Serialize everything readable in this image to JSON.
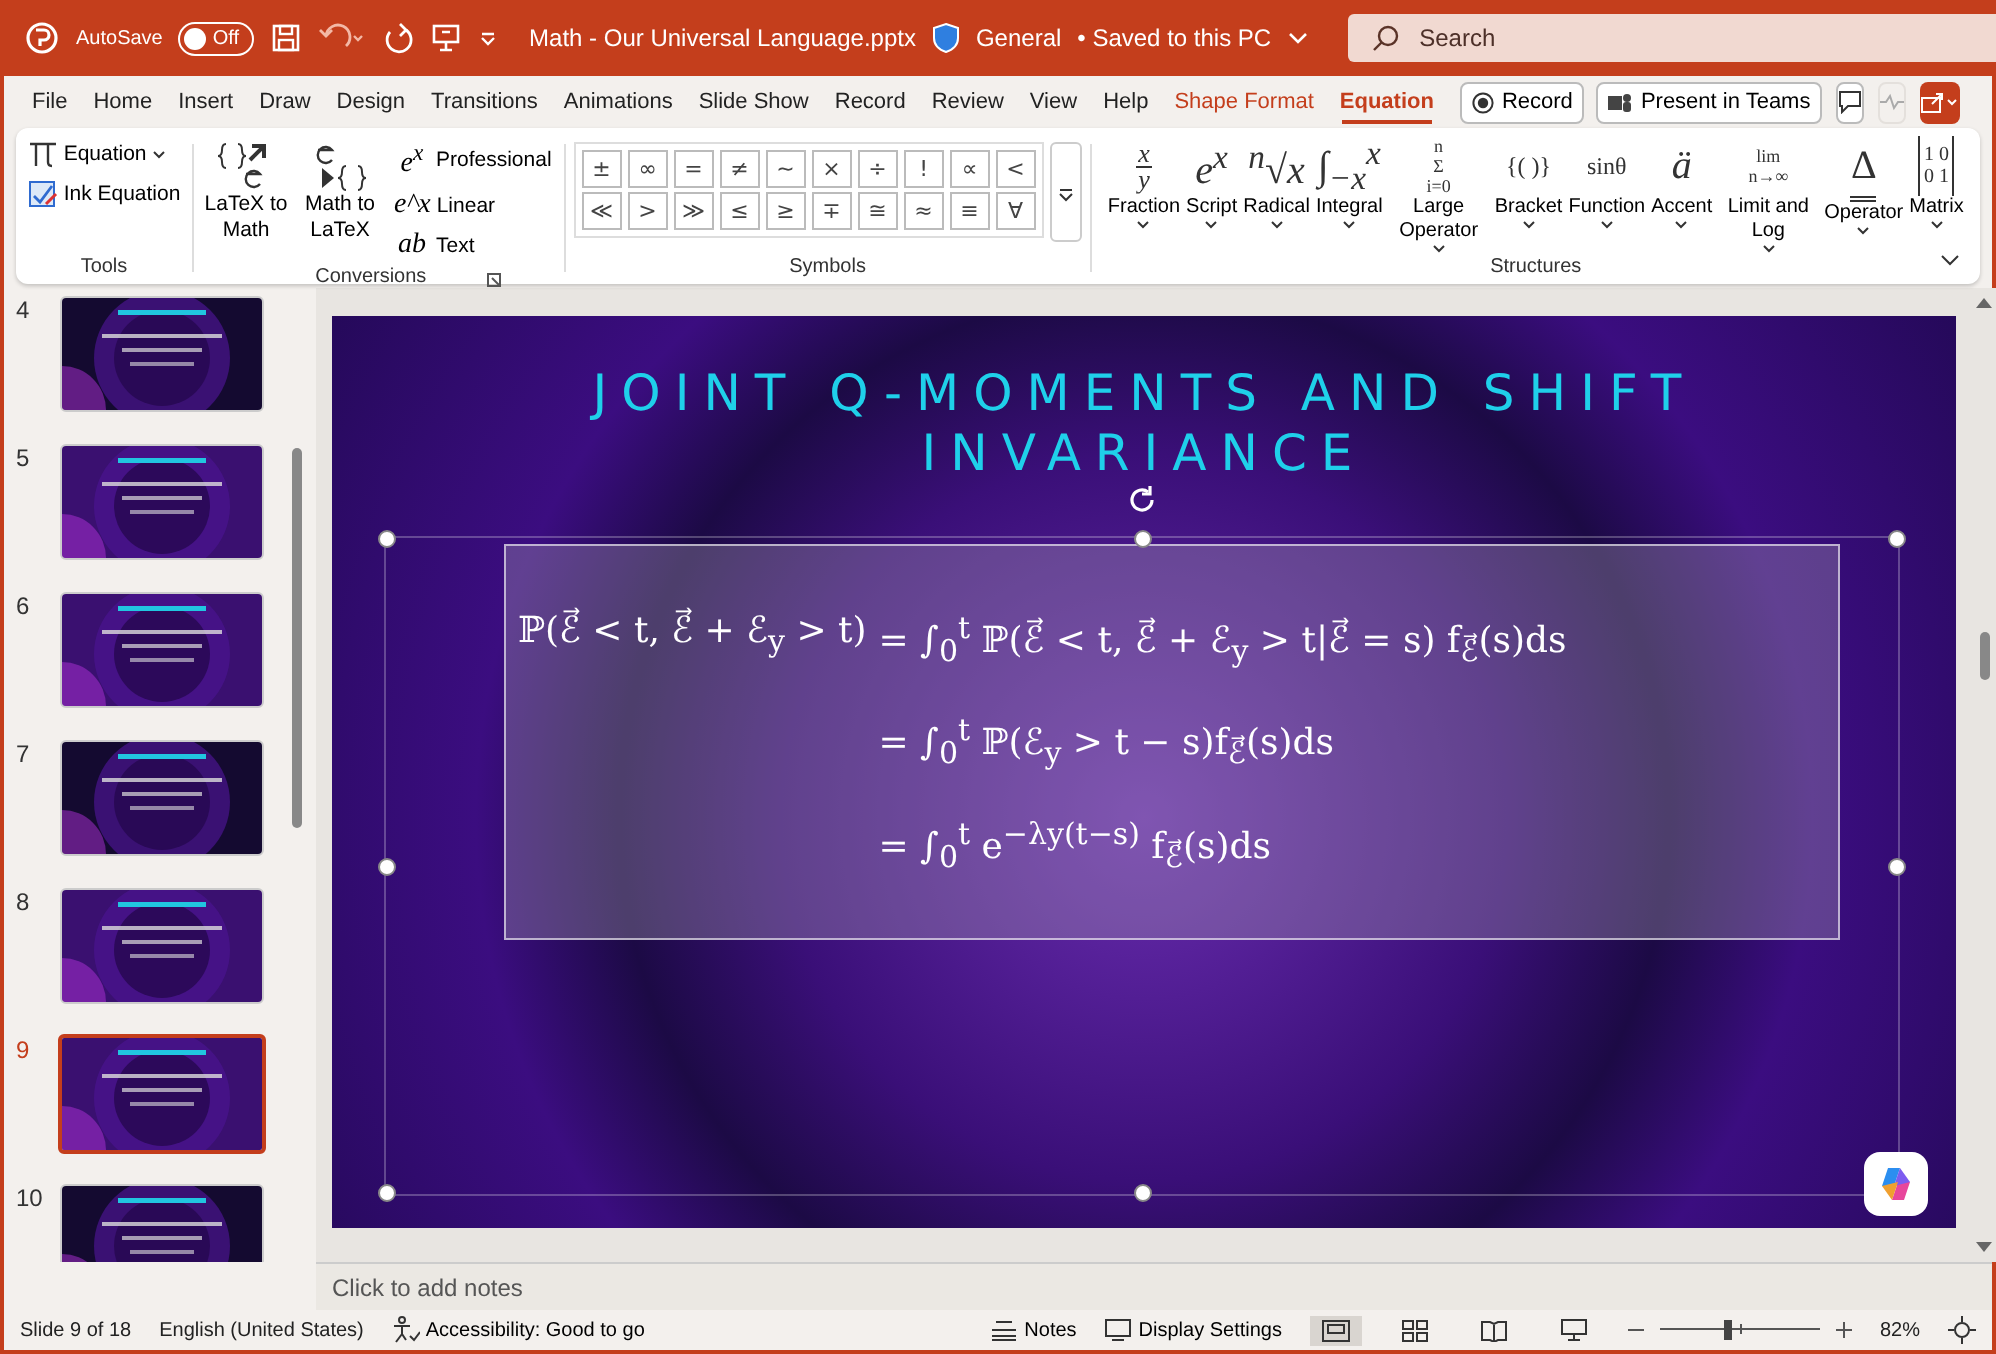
{
  "title_bar": {
    "autosave_label": "AutoSave",
    "autosave_on": false,
    "autosave_state": "Off",
    "file_name": "Math - Our Universal Language.pptx",
    "sensitivity": "General",
    "save_status": "•  Saved to this PC",
    "search_placeholder": "Search"
  },
  "tabs": [
    {
      "label": "File",
      "selected": false,
      "contextual": false
    },
    {
      "label": "Home",
      "selected": false,
      "contextual": false
    },
    {
      "label": "Insert",
      "selected": false,
      "contextual": false
    },
    {
      "label": "Draw",
      "selected": false,
      "contextual": false
    },
    {
      "label": "Design",
      "selected": false,
      "contextual": false
    },
    {
      "label": "Transitions",
      "selected": false,
      "contextual": false
    },
    {
      "label": "Animations",
      "selected": false,
      "contextual": false
    },
    {
      "label": "Slide Show",
      "selected": false,
      "contextual": false
    },
    {
      "label": "Record",
      "selected": false,
      "contextual": false
    },
    {
      "label": "Review",
      "selected": false,
      "contextual": false
    },
    {
      "label": "View",
      "selected": false,
      "contextual": false
    },
    {
      "label": "Help",
      "selected": false,
      "contextual": false
    },
    {
      "label": "Shape Format",
      "selected": false,
      "contextual": true
    },
    {
      "label": "Equation",
      "selected": true,
      "contextual": true
    }
  ],
  "tab_actions": {
    "record": "Record",
    "present": "Present in Teams"
  },
  "ribbon": {
    "tools": {
      "label": "Tools",
      "items": [
        {
          "label": "Equation",
          "dropdown": true
        },
        {
          "label": "Ink Equation",
          "dropdown": false
        }
      ]
    },
    "conversions": {
      "label": "Conversions",
      "buttons": [
        "LaTeX to Math",
        "Math to LaTeX"
      ],
      "formats": [
        {
          "glyph": "e$^{x}$",
          "label": "Professional"
        },
        {
          "glyph": "e^x",
          "label": "Linear"
        },
        {
          "glyph": "ab",
          "label": "Text"
        }
      ]
    },
    "symbols": {
      "label": "Symbols",
      "items": [
        "±",
        "∞",
        "=",
        "≠",
        "~",
        "×",
        "÷",
        "!",
        "∝",
        "<",
        "≪",
        ">",
        "≫",
        "≤",
        "≥",
        "∓",
        "≅",
        "≈",
        "≡",
        "∀"
      ]
    },
    "structures": {
      "label": "Structures",
      "items": [
        {
          "glyph": [
            "x",
            "y"
          ],
          "label": "Fraction",
          "kind": "fraction"
        },
        {
          "glyph": [
            "e$^{x}$"
          ],
          "label": "Script",
          "kind": "big"
        },
        {
          "glyph": [
            "$^{n}$√x"
          ],
          "label": "Radical",
          "kind": "big"
        },
        {
          "glyph": [
            "∫$_{−x}$$^{x}$"
          ],
          "label": "Integral",
          "kind": "big"
        },
        {
          "glyph": [
            "n",
            "Σ",
            "i=0"
          ],
          "label": "Large Operator",
          "kind": "stack"
        },
        {
          "glyph": [
            "{( )}"
          ],
          "label": "Bracket",
          "kind": "small"
        },
        {
          "glyph": [
            "sinθ"
          ],
          "label": "Function",
          "kind": "small"
        },
        {
          "glyph": [
            "ä"
          ],
          "label": "Accent",
          "kind": "big"
        },
        {
          "glyph": [
            "lim",
            "n→∞"
          ],
          "label": "Limit and Log",
          "kind": "stack"
        },
        {
          "glyph": [
            "Δ"
          ],
          "label": "Operator",
          "kind": "operator"
        },
        {
          "glyph": [
            "1 0",
            "0 1"
          ],
          "label": "Matrix",
          "kind": "matrix"
        }
      ]
    }
  },
  "thumbnails": [
    {
      "number": "4",
      "selected": false
    },
    {
      "number": "5",
      "selected": false
    },
    {
      "number": "6",
      "selected": false
    },
    {
      "number": "7",
      "selected": false
    },
    {
      "number": "8",
      "selected": false
    },
    {
      "number": "9",
      "selected": true
    },
    {
      "number": "10",
      "selected": false
    }
  ],
  "slide": {
    "title": "JOINT Q-MOMENTS AND SHIFT INVARIANCE",
    "equations": [
      {
        "lhs": "ℙ(ℰ⃗ < t, ℰ⃗ + ℰ$_{y}$ > t)",
        "rhs": "= ∫$_{0}$$^{t}$ ℙ(ℰ⃗ < t, ℰ⃗ + ℰ$_{y}$ > t|ℰ⃗ = s) f$_{ℰ⃗}$(s)ds"
      },
      {
        "rhs": "= ∫$_{0}$$^{t}$ ℙ(ℰ$_{y}$ > t − s)f$_{ℰ⃗}$(s)ds"
      },
      {
        "rhs": "= ∫$_{0}$$^{t}$ e$^{−λy(t−s)}$ f$_{ℰ⃗}$(s)ds"
      }
    ]
  },
  "notes_placeholder": "Click to add notes",
  "status_bar": {
    "slide_position": "Slide 9 of 18",
    "language": "English (United States)",
    "accessibility": "Accessibility: Good to go",
    "notes": "Notes",
    "display_settings": "Display Settings",
    "views": [
      {
        "kind": "normal",
        "selected": true
      },
      {
        "kind": "sorter",
        "selected": false
      },
      {
        "kind": "reading",
        "selected": false
      },
      {
        "kind": "slideshow",
        "selected": false
      }
    ],
    "zoom": {
      "level": 0.42,
      "reading": "82%"
    }
  }
}
